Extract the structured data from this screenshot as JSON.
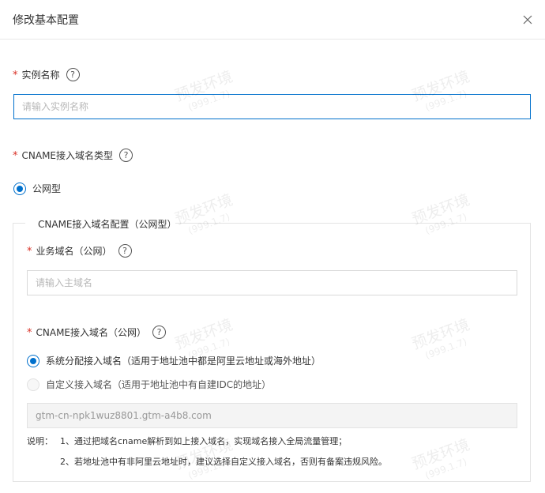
{
  "dialog": {
    "title": "修改基本配置",
    "close_icon": "close-icon"
  },
  "instance_name": {
    "label": "实例名称",
    "placeholder": "请输入实例名称",
    "value": ""
  },
  "cname_type": {
    "label": "CNAME接入域名类型",
    "options": [
      {
        "label": "公网型",
        "selected": true
      }
    ]
  },
  "cname_config": {
    "legend": "CNAME接入域名配置（公网型）",
    "business_domain": {
      "label": "业务域名（公网）",
      "placeholder": "请输入主域名",
      "value": ""
    },
    "access_domain": {
      "label": "CNAME接入域名（公网）",
      "options": [
        {
          "label": "系统分配接入域名（适用于地址池中都是阿里云地址或海外地址）",
          "selected": true
        },
        {
          "label": "自定义接入域名（适用于地址池中有自建IDC的地址）",
          "selected": false
        }
      ],
      "assigned_value": "gtm-cn-npk1wuz8801.gtm-a4b8.com"
    },
    "note_prefix": "说明：",
    "notes": [
      "1、通过把域名cname解析到如上接入域名，实现域名接入全局流量管理；",
      "2、若地址池中有非阿里云地址时，建议选择自定义接入域名，否则有备案违规风险。"
    ]
  },
  "watermark": {
    "text": "预发环境",
    "version": "(999.1.7)"
  },
  "colors": {
    "primary": "#0070cc",
    "required": "#d93026"
  }
}
